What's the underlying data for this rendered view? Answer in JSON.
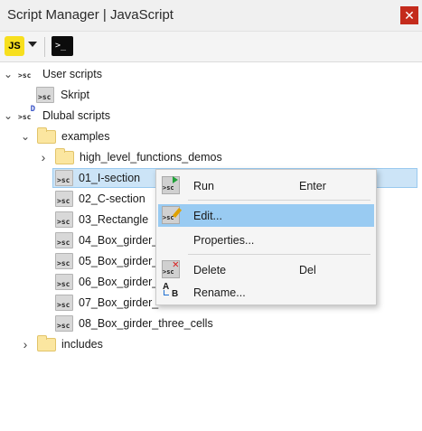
{
  "window": {
    "title": "Script Manager | JavaScript",
    "close_glyph": "✕"
  },
  "toolbar": {
    "js_label": "JS",
    "console_label": ">_"
  },
  "icon_text": {
    "sc": ">sc",
    "d_badge": "D",
    "rename_a": "A",
    "rename_b": "B"
  },
  "tree": {
    "user_scripts": {
      "label": "User scripts",
      "expander": "⌄"
    },
    "skript": {
      "label": "Skript"
    },
    "dlubal_scripts": {
      "label": "Dlubal scripts",
      "expander": "⌄"
    },
    "examples": {
      "label": "examples",
      "expander": "⌄"
    },
    "hlf": {
      "label": "high_level_functions_demos",
      "expander": "›"
    },
    "files": [
      "01_I-section",
      "02_C-section",
      "03_Rectangle",
      "04_Box_girder_",
      "05_Box_girder_",
      "06_Box_girder_",
      "07_Box_girder_",
      "08_Box_girder_three_cells"
    ],
    "includes": {
      "label": "includes",
      "expander": "›"
    }
  },
  "context_menu": {
    "run": {
      "label": "Run",
      "shortcut": "Enter"
    },
    "edit": {
      "label": "Edit..."
    },
    "properties": {
      "label": "Properties..."
    },
    "delete": {
      "label": "Delete",
      "shortcut": "Del"
    },
    "rename": {
      "label": "Rename..."
    }
  },
  "colors": {
    "selection": "#cce4f7",
    "menu_highlight": "#99cbf2",
    "close_button": "#c42b1c",
    "js_badge": "#f7df1e",
    "folder": "#fbe6a0"
  },
  "icons": {
    "js": "js-icon",
    "console": "terminal-icon",
    "script": "script-icon",
    "folder": "folder-icon",
    "run": "run-icon",
    "edit": "edit-icon",
    "delete": "delete-icon",
    "rename": "rename-icon"
  }
}
